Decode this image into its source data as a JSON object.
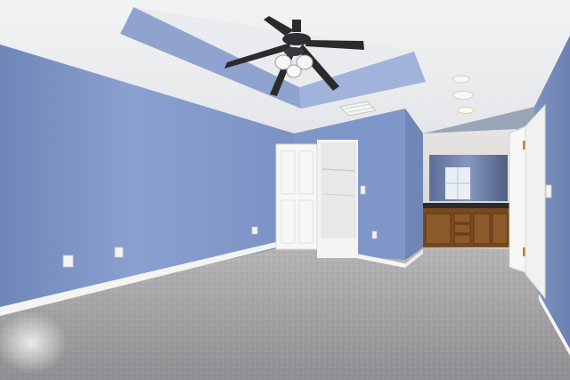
{
  "scene": {
    "subject": "empty-bedroom",
    "colors": {
      "wall": "#7f97c8",
      "ceiling": "#eef0f2",
      "carpet": "#a3a2a5",
      "trim": "#f4f4f2",
      "door": "#f7f7f5",
      "cabinet": "#7a4a1e",
      "fan": "#2b2b2e"
    },
    "icons": [
      "ceiling-fan-icon",
      "light-fixture-icon",
      "recessed-light-icon",
      "air-vent-icon",
      "electrical-outlet-icon",
      "light-switch-icon",
      "door-hinge-icon"
    ]
  }
}
